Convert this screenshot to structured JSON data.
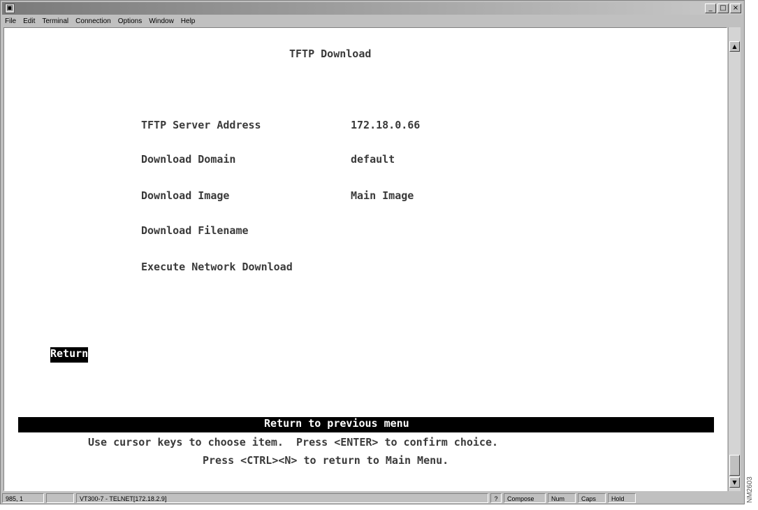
{
  "window": {
    "buttons": [
      "_",
      "□",
      "×"
    ]
  },
  "menubar": [
    "File",
    "Edit",
    "Terminal",
    "Connection",
    "Options",
    "Window",
    "Help"
  ],
  "screen": {
    "title": "TFTP Download",
    "fields": [
      {
        "label": "TFTP Server Address",
        "value": "172.18.0.66"
      },
      {
        "label": "Download Domain",
        "value": "default"
      },
      {
        "label": "Download Image",
        "value": "Main Image"
      },
      {
        "label": "Download Filename",
        "value": ""
      },
      {
        "label": "Execute Network Download",
        "value": ""
      }
    ],
    "return_label": "Return",
    "help_bar": "Return to previous menu",
    "instructions": [
      "Use cursor keys to choose item.  Press <ENTER> to confirm choice.",
      "Press <CTRL><N> to return to Main Menu."
    ]
  },
  "statusbar": {
    "position": "985, 1",
    "session": "VT300-7 - TELNET[172.18.2.9]",
    "help": "?",
    "compose": "Compose",
    "num": "Num",
    "caps": "Caps",
    "hold": "Hold"
  },
  "side_label": "NM2603",
  "icons": {
    "app": "terminal-app-icon",
    "scroll_up": "arrow-up-icon",
    "scroll_down": "arrow-down-icon"
  }
}
